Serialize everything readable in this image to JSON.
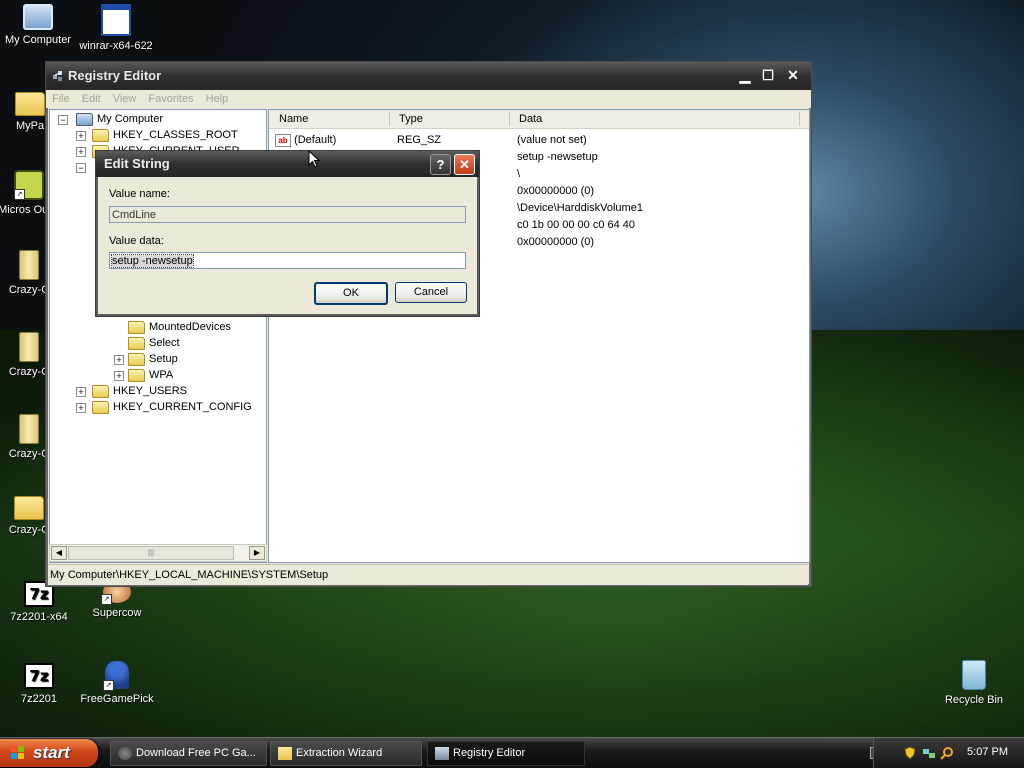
{
  "desktop": {
    "icons": [
      {
        "label": "My Computer"
      },
      {
        "label": "winrar-x64-622"
      },
      {
        "label": "MyPa"
      },
      {
        "label": "Micros Outlo"
      },
      {
        "label": "Crazy-C"
      },
      {
        "label": "Crazy-C"
      },
      {
        "label": "Crazy-C"
      },
      {
        "label": "Crazy-C"
      },
      {
        "label": "7z2201-x64"
      },
      {
        "label": "Supercow"
      },
      {
        "label": "7z2201"
      },
      {
        "label": "FreeGamePick"
      },
      {
        "label": "Recycle Bin"
      }
    ]
  },
  "regedit": {
    "title": "Registry Editor",
    "menu": [
      "File",
      "Edit",
      "View",
      "Favorites",
      "Help"
    ],
    "tree": {
      "root": "My Computer",
      "items": [
        {
          "label": "HKEY_CLASSES_ROOT"
        },
        {
          "label": "HKEY_CURRENT_USER"
        },
        {
          "label": "MountedDevices"
        },
        {
          "label": "Select"
        },
        {
          "label": "Setup"
        },
        {
          "label": "WPA"
        },
        {
          "label": "HKEY_USERS"
        },
        {
          "label": "HKEY_CURRENT_CONFIG"
        }
      ]
    },
    "columns": [
      "Name",
      "Type",
      "Data"
    ],
    "rows": [
      {
        "name": "(Default)",
        "type": "REG_SZ",
        "data": "(value not set)"
      },
      {
        "name": "",
        "type": "",
        "data": "setup -newsetup"
      },
      {
        "name": "",
        "type": "",
        "data": "\\"
      },
      {
        "name": "",
        "type": "",
        "data": "0x00000000 (0)"
      },
      {
        "name": "",
        "type": "",
        "data": "\\Device\\HarddiskVolume1"
      },
      {
        "name": "",
        "type": "",
        "data": "c0 1b 00 00 00 c0 64 40"
      },
      {
        "name": "",
        "type": "",
        "data": "0x00000000 (0)"
      }
    ],
    "status": "My Computer\\HKEY_LOCAL_MACHINE\\SYSTEM\\Setup"
  },
  "dialog": {
    "title": "Edit String",
    "value_name_label": "Value name:",
    "value_name": "CmdLine",
    "value_data_label": "Value data:",
    "value_data": "setup -newsetup",
    "ok_label": "OK",
    "cancel_label": "Cancel"
  },
  "taskbar": {
    "start_label": "start",
    "items": [
      {
        "label": "Download Free PC Ga..."
      },
      {
        "label": "Extraction Wizard"
      },
      {
        "label": "Registry Editor"
      }
    ],
    "clock": "5:07 PM"
  },
  "colors": {
    "titlebar": "#2f2f2f",
    "start_button": "#d2461a",
    "taskbar": "#1b1b1b"
  }
}
